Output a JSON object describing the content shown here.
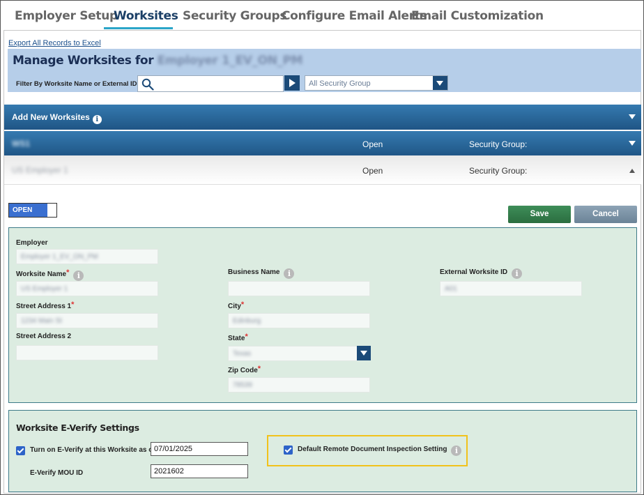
{
  "tabs": [
    {
      "label": "Employer Setup"
    },
    {
      "label": "Worksites"
    },
    {
      "label": "Security Groups"
    },
    {
      "label": "Configure Email Alerts"
    },
    {
      "label": "Email Customization"
    }
  ],
  "header": {
    "export_link": "Export All Records to Excel",
    "manage_title": "Manage Worksites for",
    "employer_name": "Employer 1_EV_ON_PM",
    "filter_label": "Filter By Worksite Name or External ID",
    "search_value": "",
    "security_group_selected": "All Security Group"
  },
  "add_new": {
    "label": "Add New Worksites"
  },
  "rows": [
    {
      "name": "WS1",
      "status": "Open",
      "security_group_label": "Security Group:"
    },
    {
      "name": "US Employer 1",
      "status": "Open",
      "security_group_label": "Security Group:"
    }
  ],
  "detail": {
    "status_badge": "OPEN",
    "save_label": "Save",
    "cancel_label": "Cancel",
    "fields": {
      "employer_label": "Employer",
      "employer_value": "Employer 1_EV_ON_PM",
      "worksite_name_label": "Worksite Name",
      "worksite_name_value": "US Employer 1",
      "business_name_label": "Business Name",
      "business_name_value": "",
      "external_id_label": "External Worksite ID",
      "external_id_value": "A01",
      "street1_label": "Street Address 1",
      "street1_value": "1234 Main St",
      "city_label": "City",
      "city_value": "Edinburg",
      "street2_label": "Street Address 2",
      "street2_value": "",
      "state_label": "State",
      "state_value": "Texas",
      "zip_label": "Zip Code",
      "zip_value": "78539",
      "required_mark": "*"
    },
    "everify": {
      "title": "Worksite E-Verify Settings",
      "turn_on_label": "Turn on E-Verify at this Worksite as of",
      "turn_on_date": "07/01/2025",
      "mou_label": "E-Verify MOU ID",
      "mou_value": "2021602",
      "remote_inspection_label": "Default Remote Document Inspection Setting"
    }
  },
  "colors": {
    "accent_bar": "#1f5585",
    "panel_bg": "#dcece1",
    "highlight": "#f1c21b",
    "save": "#2b6e40"
  }
}
